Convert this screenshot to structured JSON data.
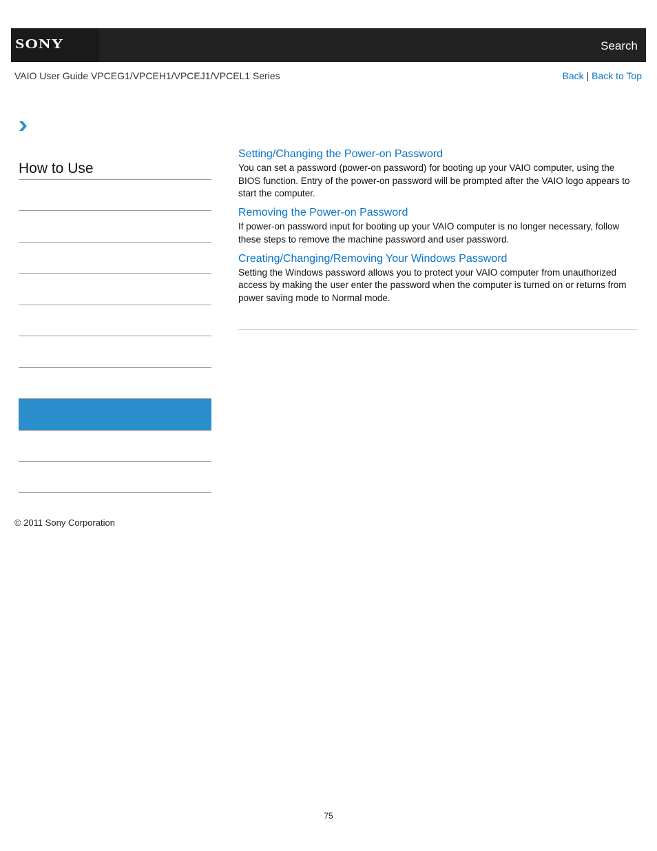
{
  "header": {
    "logo": "SONY",
    "search_label": "Search"
  },
  "subheader": {
    "guide_title": "VAIO User Guide VPCEG1/VPCEH1/VPCEJ1/VPCEL1 Series",
    "back_label": "Back",
    "separator": "|",
    "back_to_top_label": "Back to Top"
  },
  "breadcrumb": {
    "icon": "chevron-right-icon"
  },
  "sidebar": {
    "title": "How to Use",
    "items": [
      {
        "label": "",
        "active": false
      },
      {
        "label": "",
        "active": false
      },
      {
        "label": "",
        "active": false
      },
      {
        "label": "",
        "active": false
      },
      {
        "label": "",
        "active": false
      },
      {
        "label": "",
        "active": false
      },
      {
        "label": "",
        "active": false
      },
      {
        "label": "",
        "active": true
      },
      {
        "label": "",
        "active": false
      },
      {
        "label": "",
        "active": false
      }
    ],
    "active_color": "#2a8ecd"
  },
  "main": {
    "topics": [
      {
        "title": "Setting/Changing the Power-on Password",
        "description": "You can set a password (power-on password) for booting up your VAIO computer, using the BIOS function. Entry of the power-on password will be prompted after the VAIO logo appears to start the computer."
      },
      {
        "title": "Removing the Power-on Password",
        "description": "If power-on password input for booting up your VAIO computer is no longer necessary, follow these steps to remove the machine password and user password."
      },
      {
        "title": "Creating/Changing/Removing Your Windows Password",
        "description": "Setting the Windows password allows you to protect your VAIO computer from unauthorized access by making the user enter the password when the computer is turned on or returns from power saving mode to Normal mode."
      }
    ],
    "link_color": "#0a74c8"
  },
  "footer": {
    "copyright": "© 2011 Sony Corporation",
    "page_number": "75"
  }
}
